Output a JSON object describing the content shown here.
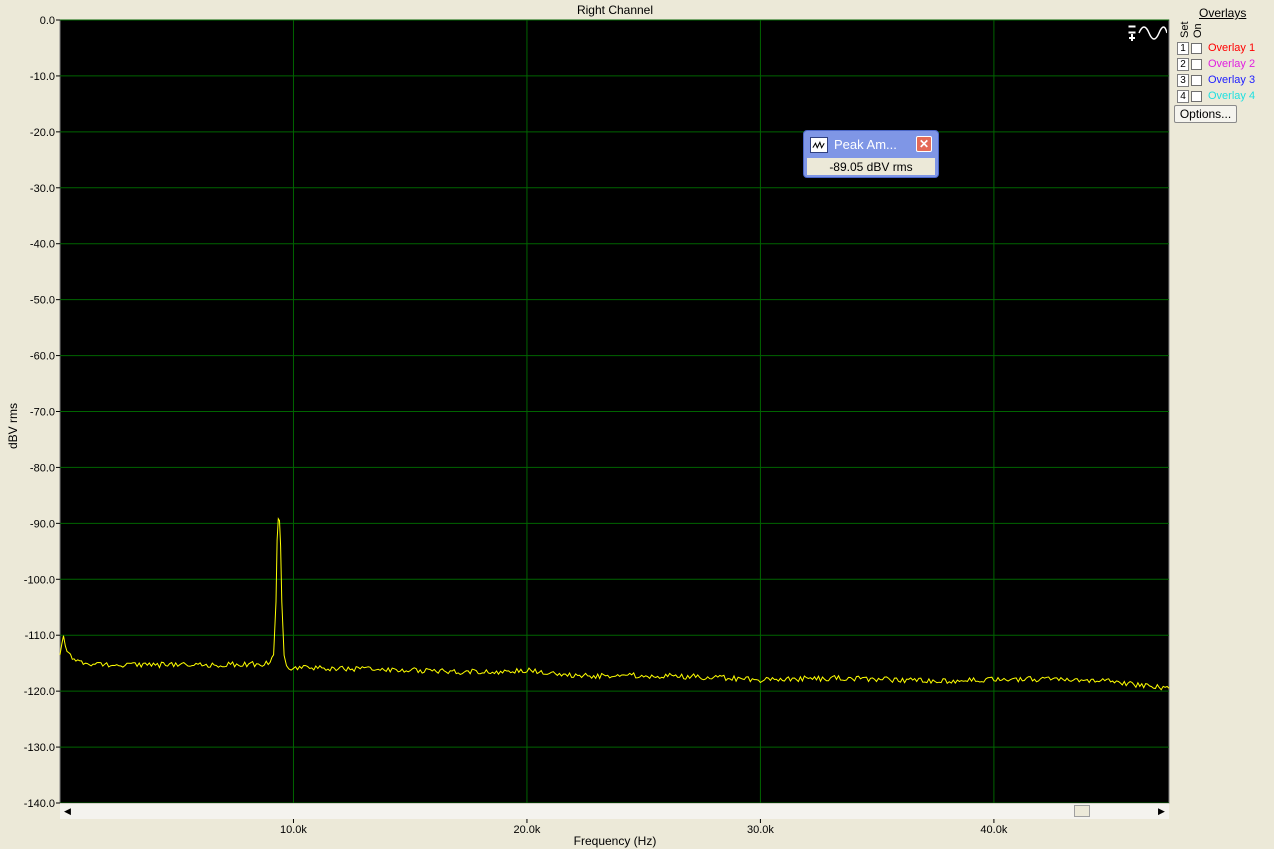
{
  "chart_data": {
    "type": "line",
    "title": "Right Channel",
    "xlabel": "Frequency (Hz)",
    "ylabel": "dBV rms",
    "xlim": [
      0,
      47500
    ],
    "ylim": [
      -140,
      0
    ],
    "yticks": [
      0,
      -10,
      -20,
      -30,
      -40,
      -50,
      -60,
      -70,
      -80,
      -90,
      -100,
      -110,
      -120,
      -130,
      -140
    ],
    "ytick_labels": [
      "0.0",
      "-10.0",
      "-20.0",
      "-30.0",
      "-40.0",
      "-50.0",
      "-60.0",
      "-70.0",
      "-80.0",
      "-90.0",
      "-100.0",
      "-110.0",
      "-120.0",
      "-130.0",
      "-140.0"
    ],
    "xticks": [
      10000,
      20000,
      30000,
      40000
    ],
    "xtick_labels": [
      "10.0k",
      "20.0k",
      "30.0k",
      "40.0k"
    ],
    "grid": true,
    "series": [
      {
        "color": "#ffff00",
        "x": [
          0,
          150,
          300,
          600,
          1000,
          2000,
          4000,
          6000,
          8000,
          9000,
          9150,
          9250,
          9300,
          9350,
          9400,
          9450,
          9500,
          9600,
          9700,
          9800,
          10000,
          12000,
          15000,
          18000,
          20000,
          22000,
          25000,
          28000,
          30000,
          33000,
          36000,
          38000,
          40000,
          42000,
          44000,
          45000,
          46000,
          47000,
          47500
        ],
        "y": [
          -113,
          -110.5,
          -112.5,
          -114.5,
          -115,
          -115.2,
          -115.3,
          -115.3,
          -115.2,
          -115,
          -113.5,
          -104,
          -93,
          -89.05,
          -89.5,
          -94,
          -104,
          -113.5,
          -115.8,
          -116,
          -115.8,
          -116,
          -116.3,
          -116.6,
          -116.3,
          -117.3,
          -117.2,
          -117.5,
          -118,
          -117.7,
          -118,
          -118.2,
          -117.8,
          -117.9,
          -118,
          -118.2,
          -118.8,
          -119.3,
          -119.5
        ]
      }
    ]
  },
  "overlays": {
    "title": "Overlays",
    "col_set": "Set",
    "col_on": "On",
    "items": [
      {
        "num": "1",
        "label": "Overlay 1",
        "color": "#ff0000"
      },
      {
        "num": "2",
        "label": "Overlay 2",
        "color": "#e020e0"
      },
      {
        "num": "3",
        "label": "Overlay 3",
        "color": "#2020ff"
      },
      {
        "num": "4",
        "label": "Overlay 4",
        "color": "#20e0e0"
      }
    ],
    "options_label": "Options..."
  },
  "peak_readout": {
    "title": "Peak Am...",
    "value": "-89.05 dBV rms",
    "close_glyph": "✕"
  },
  "scrollbar": {
    "left_glyph": "◀",
    "right_glyph": "▶"
  },
  "icons": {
    "wave": "sine-wave-icon",
    "peak": "waveform-icon"
  }
}
